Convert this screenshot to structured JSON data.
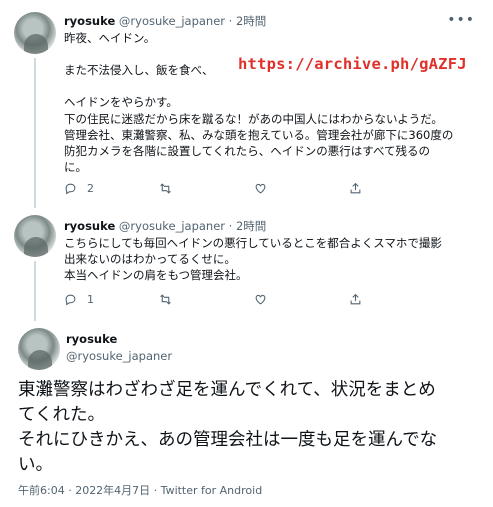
{
  "watermark": {
    "archive_url": "https://archive.ph/gAZFJ"
  },
  "tweets": [
    {
      "name": "ryosuke",
      "handle": "@ryosuke_japaner",
      "time": "2時間",
      "lines": [
        "昨夜、ヘイドン。",
        "",
        "また不法侵入し、飯を食べ、",
        "",
        "ヘイドンをやらかす。",
        "下の住民に迷惑だから床を蹴るな！があの中国人にはわからないようだ。",
        "管理会社、東灘警察、私、みな頭を抱えている。管理会社が廊下に360度の",
        "防犯カメラを各階に設置してくれたら、ヘイドンの悪行はすべて残るの",
        "に。"
      ],
      "replies": "2",
      "retweets": "",
      "likes": ""
    },
    {
      "name": "ryosuke",
      "handle": "@ryosuke_japaner",
      "time": "2時間",
      "lines": [
        "こちらにしても毎回ヘイドンの悪行しているとこを都合よくスマホで撮影",
        "出来ないのはわかってるくせに。",
        "本当ヘイドンの肩をもつ管理会社。"
      ],
      "replies": "1",
      "retweets": "",
      "likes": ""
    }
  ],
  "main_tweet": {
    "name": "ryosuke",
    "handle": "@ryosuke_japaner",
    "lines": [
      "東灘警察はわざわざ足を運んでくれて、状況をまとめ",
      "てくれた。",
      "それにひきかえ、あの管理会社は一度も足を運んでな",
      "い。"
    ],
    "meta": "午前6:04 · 2022年4月7日 · Twitter for Android"
  },
  "icons": [
    "more-icon",
    "reply-icon",
    "retweet-icon",
    "like-icon",
    "share-icon",
    "avatar"
  ],
  "colors": {
    "text": "#0f1419",
    "muted": "#536471",
    "watermark": "#e0302a",
    "divider": "#eff3f4"
  }
}
